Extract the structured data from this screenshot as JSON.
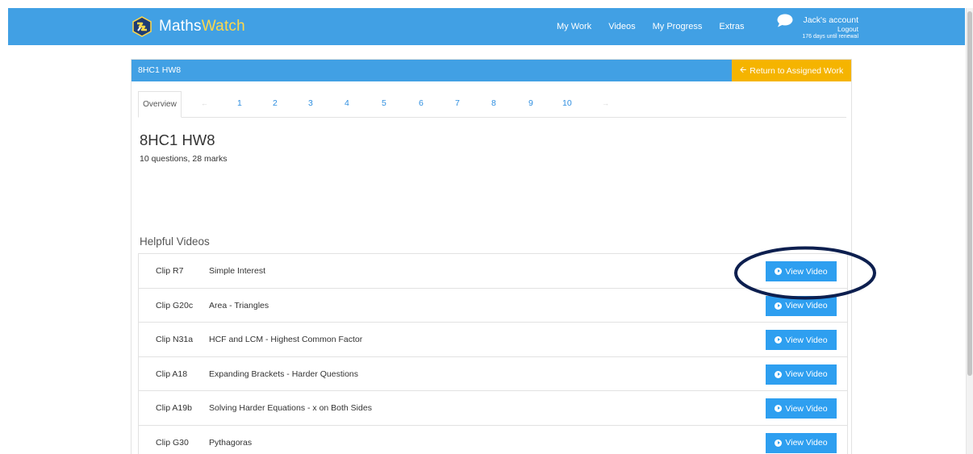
{
  "navbar": {
    "logo_text_part1": "Maths",
    "logo_text_part2": "Watch",
    "links": [
      "My Work",
      "Videos",
      "My Progress",
      "Extras"
    ],
    "account_name": "Jack's account",
    "logout_label": "Logout",
    "renewal_text": "176 days until renewal",
    "color": "#41a0e4"
  },
  "panel": {
    "header_title": "8HC1 HW8",
    "return_label": "Return to Assigned Work",
    "return_color": "#f5b400"
  },
  "tabs": {
    "overview_label": "Overview",
    "numbers": [
      "1",
      "2",
      "3",
      "4",
      "5",
      "6",
      "7",
      "8",
      "9",
      "10"
    ]
  },
  "overview": {
    "title": "8HC1 HW8",
    "summary": "10 questions, 28 marks"
  },
  "helpful_videos": {
    "heading": "Helpful Videos",
    "button_label": "View Video",
    "items": [
      {
        "code": "Clip R7",
        "title": "Simple Interest"
      },
      {
        "code": "Clip G20c",
        "title": "Area - Triangles"
      },
      {
        "code": "Clip N31a",
        "title": "HCF and LCM - Highest Common Factor"
      },
      {
        "code": "Clip A18",
        "title": "Expanding Brackets - Harder Questions"
      },
      {
        "code": "Clip A19b",
        "title": "Solving Harder Equations - x on Both Sides"
      },
      {
        "code": "Clip G30",
        "title": "Pythagoras"
      }
    ]
  },
  "annotation": {
    "color": "#0d1f4f"
  }
}
